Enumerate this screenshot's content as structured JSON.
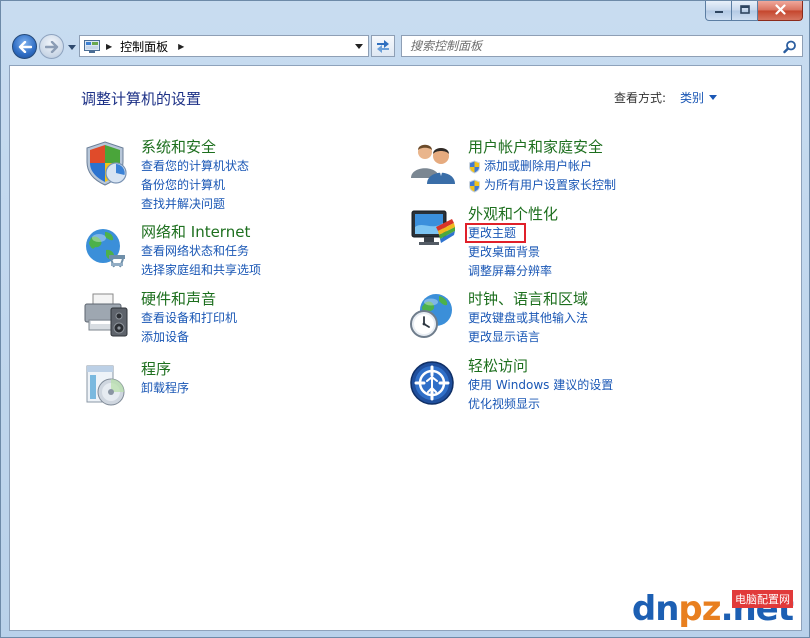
{
  "window": {
    "address": {
      "path": "控制面板"
    },
    "search": {
      "placeholder": "搜索控制面板"
    }
  },
  "main": {
    "title": "调整计算机的设置",
    "view_by_label": "查看方式:",
    "view_by_value": "类别",
    "categories": [
      {
        "title": "系统和安全",
        "icon": "system-security-icon",
        "links": [
          "查看您的计算机状态",
          "备份您的计算机",
          "查找并解决问题"
        ]
      },
      {
        "title": "网络和 Internet",
        "icon": "network-internet-icon",
        "links": [
          "查看网络状态和任务",
          "选择家庭组和共享选项"
        ]
      },
      {
        "title": "硬件和声音",
        "icon": "hardware-sound-icon",
        "links": [
          "查看设备和打印机",
          "添加设备"
        ]
      },
      {
        "title": "程序",
        "icon": "programs-icon",
        "links": [
          "卸载程序"
        ]
      },
      {
        "title": "用户帐户和家庭安全",
        "icon": "user-accounts-icon",
        "links": [
          "添加或删除用户帐户",
          "为所有用户设置家长控制"
        ]
      },
      {
        "title": "外观和个性化",
        "icon": "appearance-icon",
        "links": [
          "更改主题",
          "更改桌面背景",
          "调整屏幕分辨率"
        ]
      },
      {
        "title": "时钟、语言和区域",
        "icon": "clock-language-icon",
        "links": [
          "更改键盘或其他输入法",
          "更改显示语言"
        ]
      },
      {
        "title": "轻松访问",
        "icon": "ease-of-access-icon",
        "links": [
          "使用 Windows 建议的设置",
          "优化视频显示"
        ]
      }
    ]
  },
  "watermark": {
    "logo_a": "dn",
    "logo_b": "pz",
    "logo_c": ".net",
    "tag": "电脑配置网"
  },
  "colors": {
    "category_title": "#1d6f1e",
    "link": "#1a57b5",
    "page_title": "#1e3287",
    "highlight": "#e0202a"
  }
}
